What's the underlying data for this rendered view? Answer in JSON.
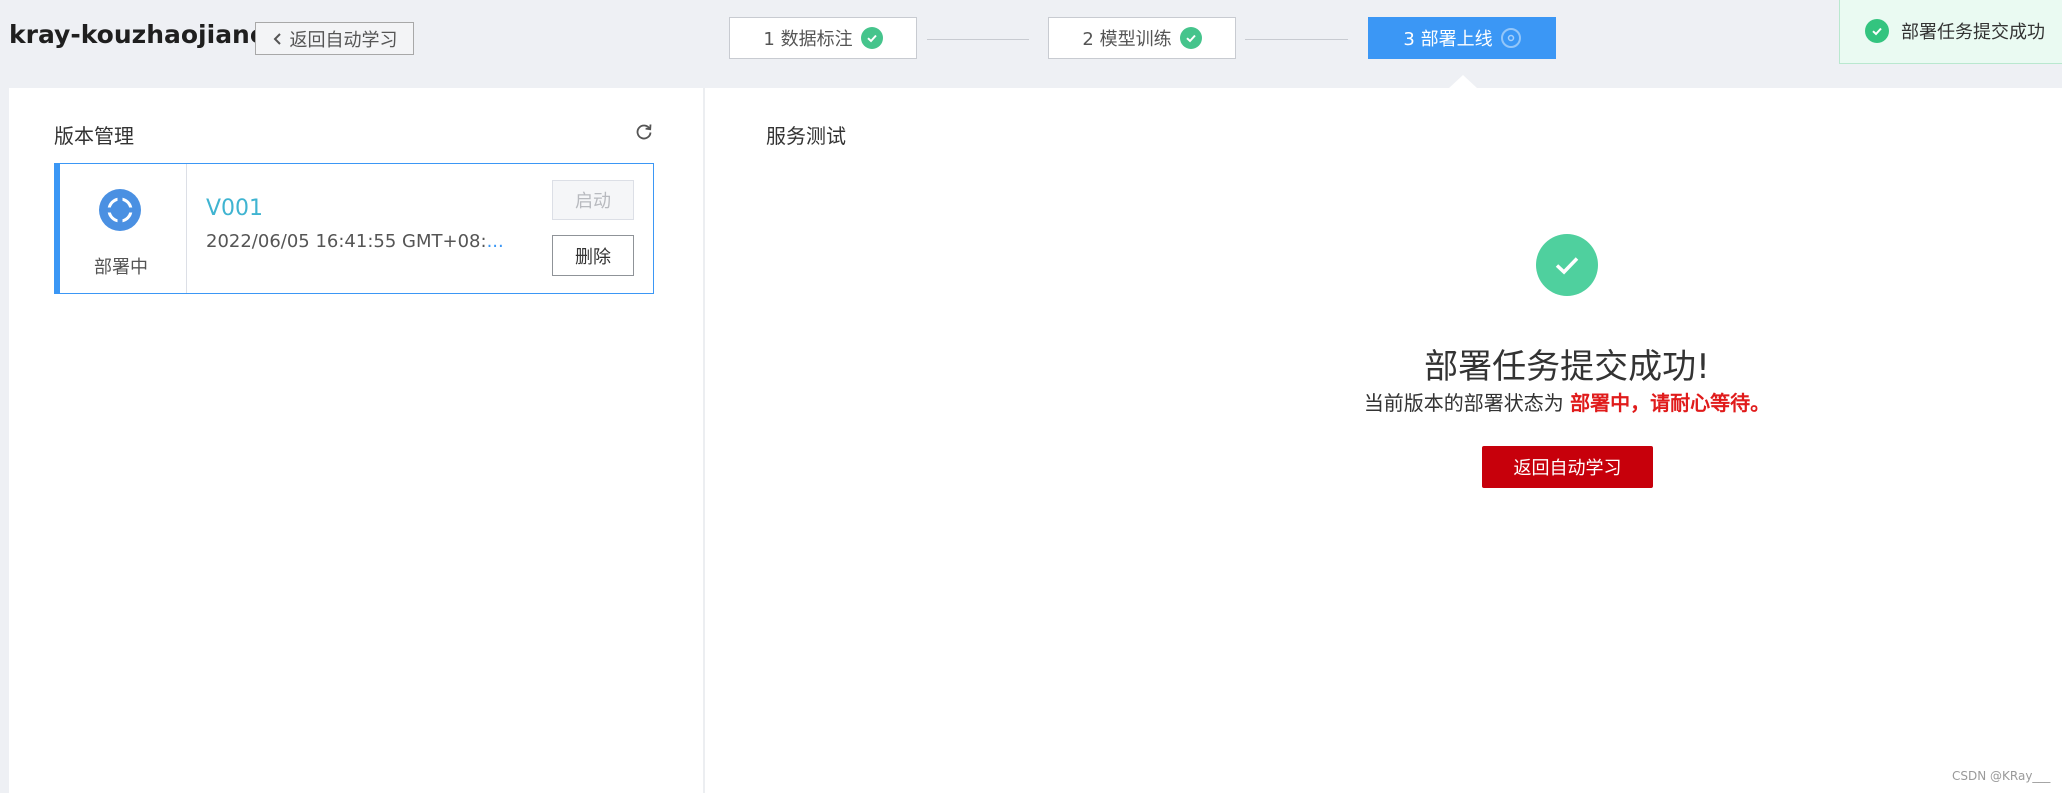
{
  "header": {
    "app_title": "kray-kouzhaojiance",
    "back_button_label": "返回自动学习"
  },
  "steps": [
    {
      "label": "1 数据标注",
      "status": "completed"
    },
    {
      "label": "2 模型训练",
      "status": "completed"
    },
    {
      "label": "3 部署上线",
      "status": "active"
    }
  ],
  "toast": {
    "message": "部署任务提交成功"
  },
  "version_panel": {
    "title": "版本管理",
    "card": {
      "status": "部署中",
      "version": "V001",
      "time": "2022/06/05 16:41:55 GMT+08:",
      "time_ellipsis": "...",
      "start_label": "启动",
      "delete_label": "删除"
    }
  },
  "service_panel": {
    "title": "服务测试",
    "success_title": "部署任务提交成功!",
    "success_desc_prefix": "当前版本的部署状态为 ",
    "success_desc_highlight": "部署中，请耐心等待。",
    "return_label": "返回自动学习"
  },
  "watermark": "CSDN @KRay___",
  "colors": {
    "accent_blue": "#3b97f5",
    "success_green": "#4fd09e",
    "brand_red": "#c7000b",
    "highlight_red": "#e01b1b"
  },
  "icons": {
    "back": "chevron-left-icon",
    "step_done": "check-circle-icon",
    "step_pending": "gear-circle-icon",
    "toast": "check-circle-icon",
    "refresh": "refresh-icon",
    "deploy_status": "deploying-icon",
    "success": "success-check-icon"
  }
}
